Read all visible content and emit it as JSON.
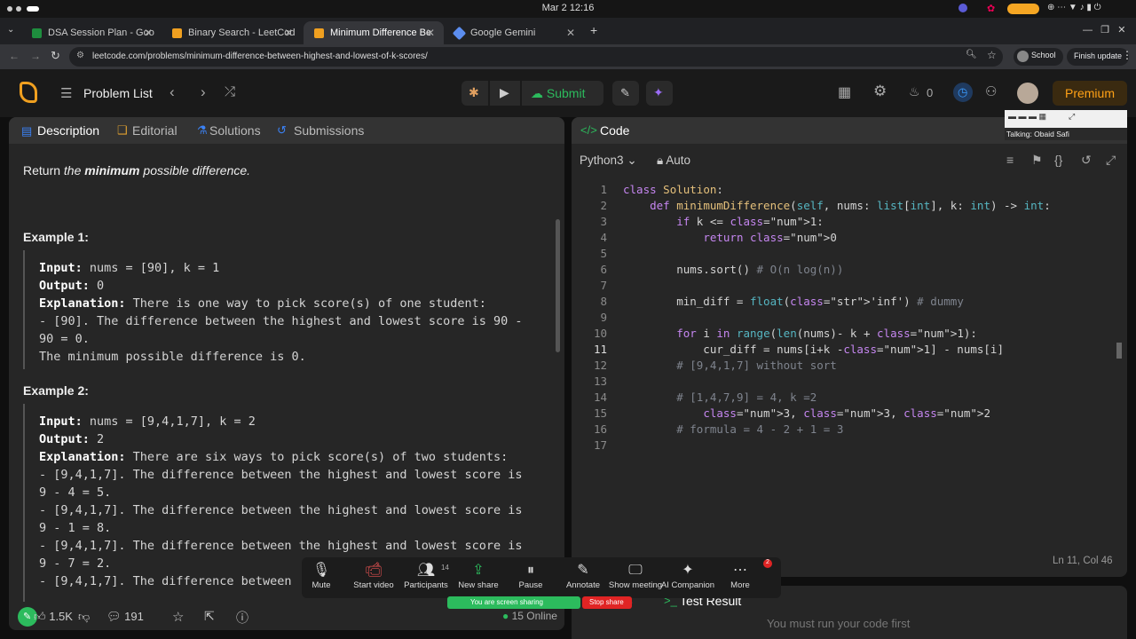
{
  "os": {
    "clock": "Mar 2  12:16"
  },
  "tabs": [
    {
      "label": "DSA Session Plan - Goo",
      "icon_color": "#1e8e3e"
    },
    {
      "label": "Binary Search - LeetCod",
      "icon_color": "#f0a020"
    },
    {
      "label": "Minimum Difference Be",
      "icon_color": "#f0a020"
    },
    {
      "label": "Google Gemini",
      "icon_color": "#5b8def"
    }
  ],
  "browser": {
    "url": "leetcode.com/problems/minimum-difference-between-highest-and-lowest-of-k-scores/",
    "profile": "School",
    "update": "Finish update"
  },
  "header": {
    "problem_list": "Problem List",
    "submit": "Submit",
    "fire_count": "0",
    "premium": "Premium"
  },
  "left_tabs": [
    "Description",
    "Editorial",
    "Solutions",
    "Submissions"
  ],
  "description": {
    "return_prefix": "Return ",
    "return_the": "the ",
    "return_min": "minimum",
    "return_suffix": " possible difference.",
    "ex1_title": "Example 1:",
    "ex1_lines": [
      {
        "b": "Input:",
        "t": " nums = [90], k = 1"
      },
      {
        "b": "Output:",
        "t": " 0"
      },
      {
        "b": "Explanation:",
        "t": " There is one way to pick score(s) of one student:"
      },
      {
        "b": "",
        "t": "- [90]. The difference between the highest and lowest score is 90 -"
      },
      {
        "b": "",
        "t": "90 = 0."
      },
      {
        "b": "",
        "t": "The minimum possible difference is 0."
      }
    ],
    "ex2_title": "Example 2:",
    "ex2_lines": [
      {
        "b": "Input:",
        "t": " nums = [9,4,1,7], k = 2"
      },
      {
        "b": "Output:",
        "t": " 2"
      },
      {
        "b": "Explanation:",
        "t": " There are six ways to pick score(s) of two students:"
      },
      {
        "b": "",
        "t": "- [9,4,1,7]. The difference between the highest and lowest score is"
      },
      {
        "b": "",
        "t": "9 - 4 = 5."
      },
      {
        "b": "",
        "t": "- [9,4,1,7]. The difference between the highest and lowest score is"
      },
      {
        "b": "",
        "t": "9 - 1 = 8."
      },
      {
        "b": "",
        "t": "- [9,4,1,7]. The difference between the highest and lowest score is"
      },
      {
        "b": "",
        "t": "9 - 7 = 2."
      },
      {
        "b": "",
        "t": "- [9,4,1,7]. The difference between"
      }
    ]
  },
  "left_footer": {
    "likes": "1.5K",
    "comments": "191",
    "online": "15 Online"
  },
  "code_panel": {
    "title": "Code",
    "language": "Python3",
    "mode": "Auto",
    "talking": "Talking: Obaid Safi",
    "status": "Ln 11, Col 46",
    "lines": [
      "class Solution:",
      "    def minimumDifference(self, nums: list[int], k: int) -> int:",
      "        if k <= 1:",
      "            return 0",
      "",
      "        nums.sort() # O(n log(n))",
      "",
      "        min_diff = float('inf') # dummy",
      "",
      "        for i in range(len(nums)- k + 1):",
      "            cur_diff = nums[i+k -1] - nums[i]",
      "        # [9,4,1,7] without sort",
      "",
      "        # [1,4,7,9] = 4, k =2",
      "            3, 3, 2",
      "        # formula = 4 - 2 + 1 = 3",
      ""
    ]
  },
  "result": {
    "tab_partial": "se",
    "tab": "Test Result",
    "message": "You must run your code first"
  },
  "zoom": {
    "items": [
      "Mute",
      "Start video",
      "Participants",
      "New share",
      "Pause",
      "Annotate",
      "Show meeting",
      "AI Companion",
      "More"
    ],
    "participants_count": "14",
    "more_badge": "2",
    "sharing": "You are screen sharing",
    "stop": "Stop share"
  }
}
